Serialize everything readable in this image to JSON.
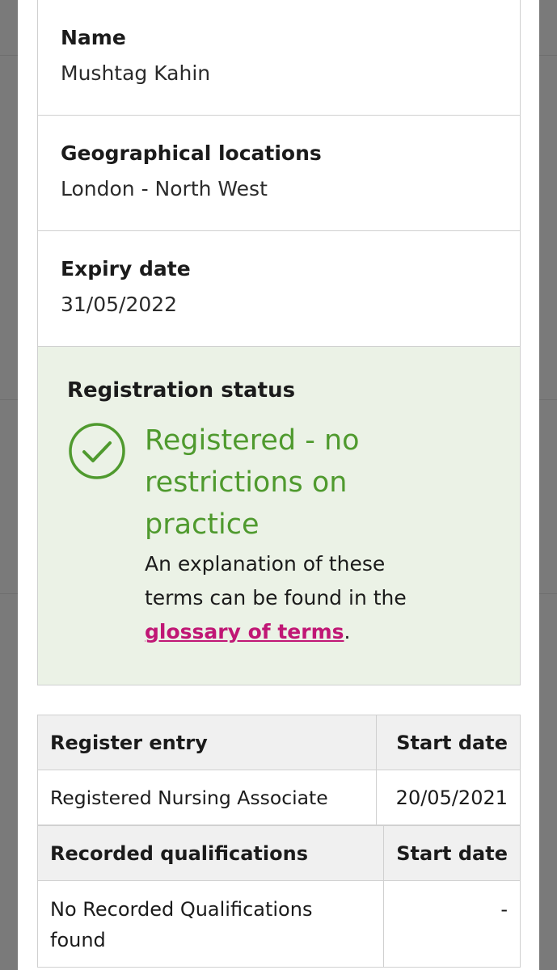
{
  "details": {
    "name_label": "Name",
    "name_value": "Mushtag Kahin",
    "location_label": "Geographical locations",
    "location_value": "London - North West",
    "expiry_label": "Expiry date",
    "expiry_value": "31/05/2022"
  },
  "status": {
    "title": "Registration status",
    "value": "Registered - no restrictions on practice",
    "explanation_prefix": "An explanation of these terms can be found in the ",
    "glossary_link": "glossary of terms",
    "explanation_suffix": ".",
    "icon": "check-circle-icon",
    "color": "#4f9a2e",
    "background": "#ebf2e6",
    "link_color": "#c01775"
  },
  "register_table": {
    "headers": [
      "Register entry",
      "Start date"
    ],
    "rows": [
      [
        "Registered Nursing Associate",
        "20/05/2021"
      ]
    ]
  },
  "qualifications_table": {
    "headers": [
      "Recorded qualifications",
      "Start date"
    ],
    "rows": [
      [
        "No Recorded Qualifications found",
        "-"
      ]
    ]
  }
}
